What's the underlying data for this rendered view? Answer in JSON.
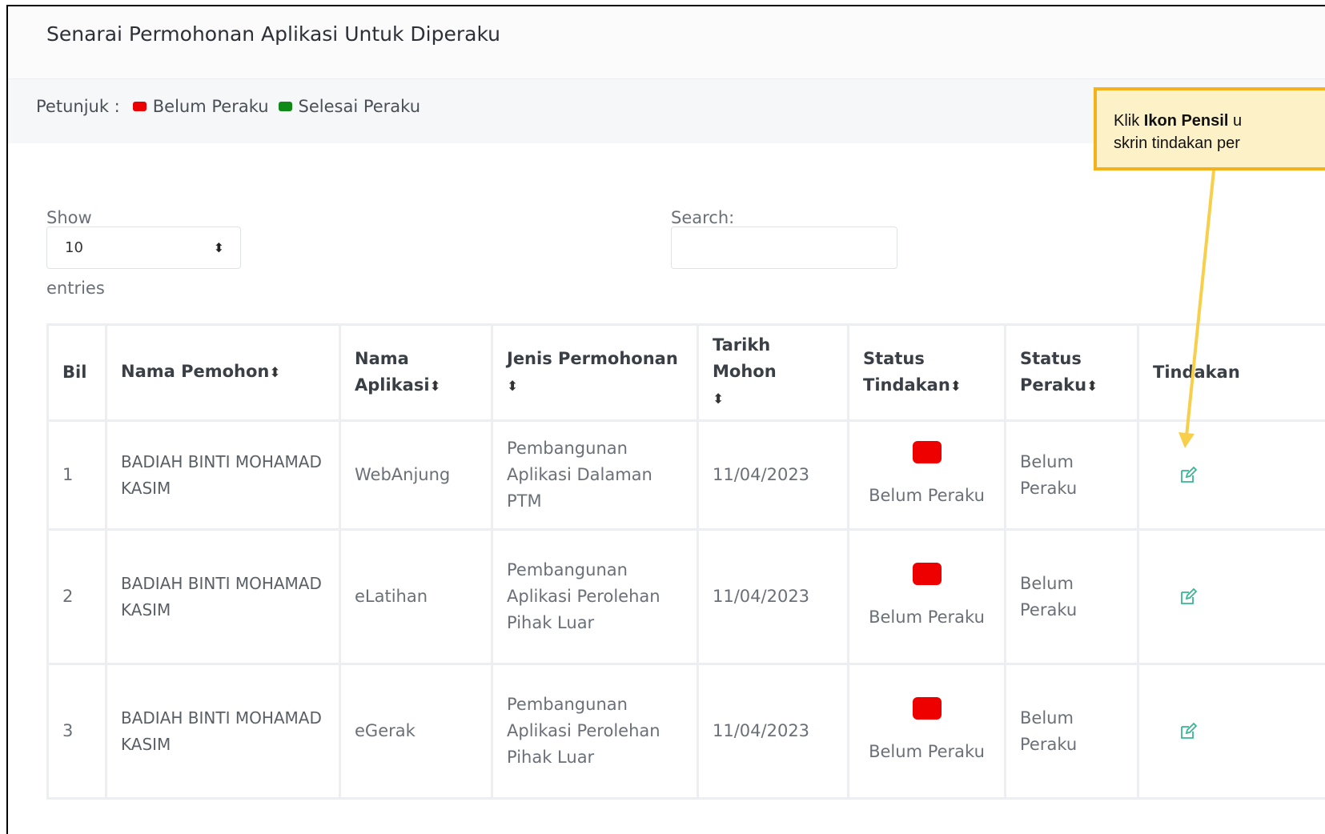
{
  "page": {
    "title": "Senarai Permohonan Aplikasi Untuk Diperaku"
  },
  "legend": {
    "label": "Petunjuk :",
    "items": [
      {
        "label": "Belum Peraku",
        "color": "#ea0000"
      },
      {
        "label": "Selesai Peraku",
        "color": "#0f8a17"
      }
    ]
  },
  "controls": {
    "show_label": "Show",
    "length_value": "10",
    "entries_label": "entries",
    "search_label": "Search:",
    "search_value": ""
  },
  "table": {
    "headers": {
      "bil": "Bil",
      "nama_pemohon": "Nama Pemohon",
      "nama_aplikasi": "Nama Aplikasi",
      "jenis_permohonan": "Jenis Permohonan",
      "tarikh_mohon": "Tarikh Mohon",
      "status_tindakan": "Status Tindakan",
      "status_peraku": "Status Peraku",
      "tindakan": "Tindakan"
    },
    "sort_icon": "sort-updown-icon",
    "rows": [
      {
        "bil": "1",
        "nama_pemohon": "BADIAH BINTI MOHAMAD KASIM",
        "nama_aplikasi": "WebAnjung",
        "jenis_permohonan": "Pembangunan Aplikasi Dalaman PTM",
        "tarikh_mohon": "11/04/2023",
        "status_tindakan": "Belum Peraku",
        "status_color": "#ee0000",
        "status_peraku": "Belum Peraku",
        "tindakan_icon": "edit-pencil-icon"
      },
      {
        "bil": "2",
        "nama_pemohon": "BADIAH BINTI MOHAMAD KASIM",
        "nama_aplikasi": "eLatihan",
        "jenis_permohonan": "Pembangunan Aplikasi Perolehan Pihak Luar",
        "tarikh_mohon": "11/04/2023",
        "status_tindakan": "Belum Peraku",
        "status_color": "#ee0000",
        "status_peraku": "Belum Peraku",
        "tindakan_icon": "edit-pencil-icon"
      },
      {
        "bil": "3",
        "nama_pemohon": "BADIAH BINTI MOHAMAD KASIM",
        "nama_aplikasi": "eGerak",
        "jenis_permohonan": "Pembangunan Aplikasi Perolehan Pihak Luar",
        "tarikh_mohon": "11/04/2023",
        "status_tindakan": "Belum Peraku",
        "status_color": "#ee0000",
        "status_peraku": "Belum Peraku",
        "tindakan_icon": "edit-pencil-icon"
      }
    ]
  },
  "callout": {
    "prefix": "Klik ",
    "bold": "Ikon Pensil",
    "rest_line1": " u",
    "line2": "skrin tindakan per",
    "arrow_color": "#f7cf4a"
  }
}
